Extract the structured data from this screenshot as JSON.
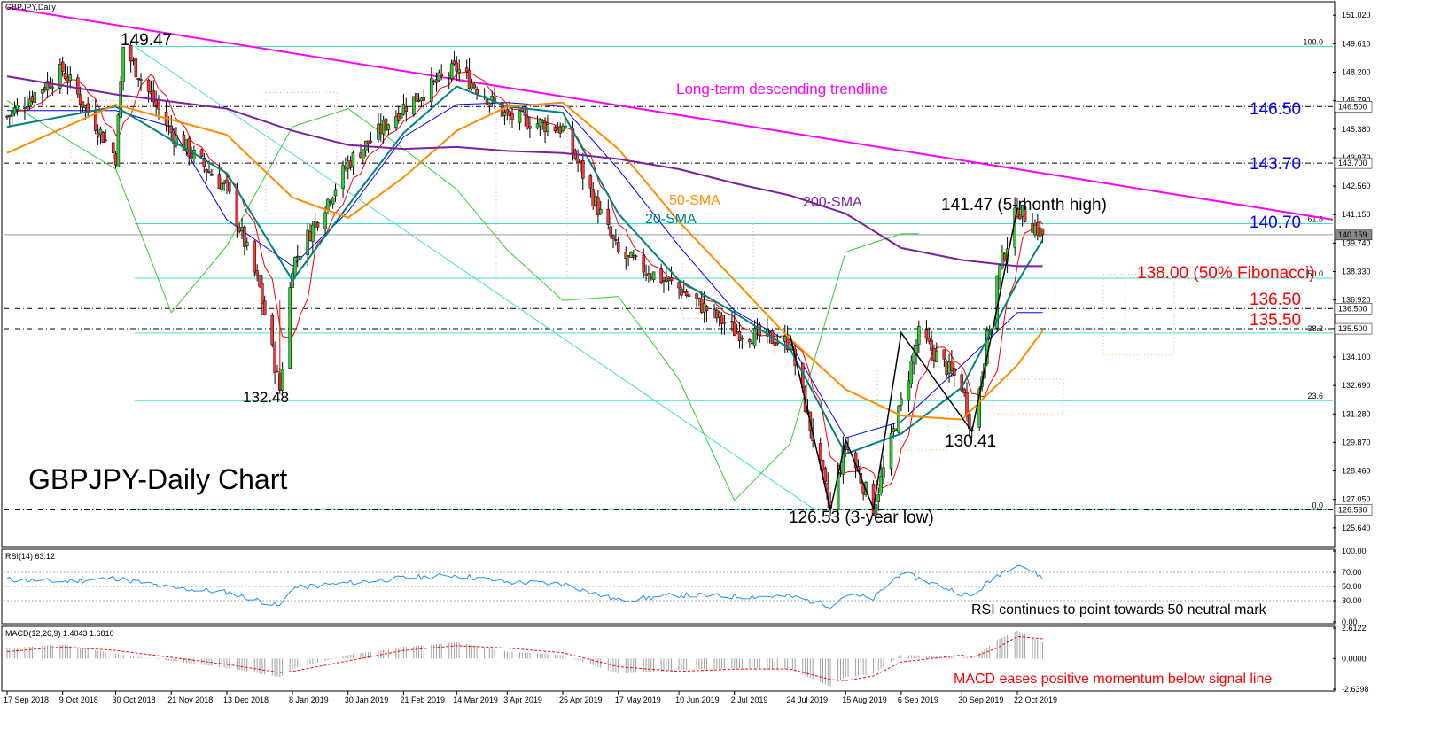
{
  "chart_data": [
    {
      "type": "candlestick",
      "title": "GBPJPY-Daily Chart",
      "symbol_label": "GBPJPY,Daily",
      "price_axis": {
        "ylim": [
          124.8,
          151.6
        ],
        "ticks": [
          "151.020",
          "149.610",
          "148.200",
          "146.790",
          "145.380",
          "143.970",
          "142.560",
          "141.150",
          "139.740",
          "138.330",
          "136.920",
          "135.510",
          "134.100",
          "132.690",
          "131.280",
          "129.870",
          "128.460",
          "127.050",
          "125.640"
        ],
        "tick_values": [
          151.02,
          149.61,
          148.2,
          146.79,
          145.38,
          143.97,
          142.56,
          141.15,
          139.74,
          138.33,
          136.92,
          135.51,
          134.1,
          132.69,
          131.28,
          129.87,
          128.46,
          127.05,
          125.64
        ],
        "current_price": "140.159",
        "current_price_value": 140.159
      },
      "x_axis": {
        "tick_labels": [
          "17 Sep 2018",
          "9 Oct 2018",
          "30 Oct 2018",
          "21 Nov 2018",
          "13 Dec 2018",
          "8 Jan 2019",
          "30 Jan 2019",
          "21 Feb 2019",
          "14 Mar 2019",
          "3 Apr 2019",
          "25 Apr 2019",
          "17 May 2019",
          "10 Jun 2019",
          "2 Jul 2019",
          "24 Jul 2019",
          "15 Aug 2019",
          "6 Sep 2019",
          "30 Sep 2019",
          "22 Oct 2019"
        ]
      },
      "price_path": {
        "name": "GBPJPY close",
        "points": [
          [
            "17 Sep 2018",
            146.0
          ],
          [
            "9 Oct 2018",
            148.3
          ],
          [
            "30 Oct 2018",
            144.0
          ],
          [
            "2 Nov 2018",
            149.47
          ],
          [
            "21 Nov 2018",
            145.2
          ],
          [
            "13 Dec 2018",
            142.4
          ],
          [
            "26 Dec 2018",
            137.5
          ],
          [
            "3 Jan 2019",
            132.48
          ],
          [
            "8 Jan 2019",
            138.7
          ],
          [
            "30 Jan 2019",
            143.7
          ],
          [
            "21 Feb 2019",
            146.5
          ],
          [
            "14 Mar 2019",
            148.4
          ],
          [
            "3 Apr 2019",
            146.0
          ],
          [
            "25 Apr 2019",
            145.4
          ],
          [
            "17 May 2019",
            139.2
          ],
          [
            "10 Jun 2019",
            137.5
          ],
          [
            "2 Jul 2019",
            135.4
          ],
          [
            "24 Jul 2019",
            134.8
          ],
          [
            "9 Aug 2019",
            126.53
          ],
          [
            "15 Aug 2019",
            129.8
          ],
          [
            "26 Aug 2019",
            126.6
          ],
          [
            "6 Sep 2019",
            131.8
          ],
          [
            "13 Sep 2019",
            135.2
          ],
          [
            "30 Sep 2019",
            132.7
          ],
          [
            "4 Oct 2019",
            130.41
          ],
          [
            "14 Oct 2019",
            138.0
          ],
          [
            "22 Oct 2019",
            141.47
          ],
          [
            "1 Nov 2019",
            140.16
          ]
        ]
      },
      "moving_averages": [
        {
          "name": "20-SMA",
          "color": "#008080",
          "points": [
            [
              "17 Sep 2018",
              145.5
            ],
            [
              "30 Oct 2018",
              146.5
            ],
            [
              "13 Dec 2018",
              143.2
            ],
            [
              "8 Jan 2019",
              137.9
            ],
            [
              "30 Jan 2019",
              141.6
            ],
            [
              "21 Feb 2019",
              145.2
            ],
            [
              "14 Mar 2019",
              147.5
            ],
            [
              "3 Apr 2019",
              146.5
            ],
            [
              "25 Apr 2019",
              146.2
            ],
            [
              "17 May 2019",
              141.2
            ],
            [
              "10 Jun 2019",
              137.9
            ],
            [
              "2 Jul 2019",
              136.3
            ],
            [
              "24 Jul 2019",
              134.5
            ],
            [
              "15 Aug 2019",
              129.3
            ],
            [
              "6 Sep 2019",
              130.3
            ],
            [
              "30 Sep 2019",
              132.6
            ],
            [
              "22 Oct 2019",
              137.8
            ],
            [
              "1 Nov 2019",
              139.9
            ]
          ]
        },
        {
          "name": "50-SMA",
          "color": "#ff8c00",
          "points": [
            [
              "17 Sep 2018",
              144.2
            ],
            [
              "30 Oct 2018",
              146.6
            ],
            [
              "13 Dec 2018",
              145.1
            ],
            [
              "8 Jan 2019",
              142.0
            ],
            [
              "30 Jan 2019",
              141.0
            ],
            [
              "21 Feb 2019",
              143.0
            ],
            [
              "14 Mar 2019",
              145.3
            ],
            [
              "3 Apr 2019",
              146.5
            ],
            [
              "25 Apr 2019",
              146.7
            ],
            [
              "17 May 2019",
              144.4
            ],
            [
              "10 Jun 2019",
              140.8
            ],
            [
              "2 Jul 2019",
              137.9
            ],
            [
              "24 Jul 2019",
              135.0
            ],
            [
              "15 Aug 2019",
              132.5
            ],
            [
              "6 Sep 2019",
              131.2
            ],
            [
              "30 Sep 2019",
              131.0
            ],
            [
              "22 Oct 2019",
              133.7
            ],
            [
              "1 Nov 2019",
              135.4
            ]
          ]
        },
        {
          "name": "200-SMA",
          "color": "#7b1fa2",
          "points": [
            [
              "17 Sep 2018",
              148.0
            ],
            [
              "30 Oct 2018",
              147.1
            ],
            [
              "13 Dec 2018",
              146.4
            ],
            [
              "8 Jan 2019",
              145.3
            ],
            [
              "30 Jan 2019",
              144.6
            ],
            [
              "21 Feb 2019",
              144.4
            ],
            [
              "14 Mar 2019",
              144.5
            ],
            [
              "3 Apr 2019",
              144.3
            ],
            [
              "25 Apr 2019",
              144.2
            ],
            [
              "17 May 2019",
              143.9
            ],
            [
              "10 Jun 2019",
              143.4
            ],
            [
              "2 Jul 2019",
              142.7
            ],
            [
              "24 Jul 2019",
              142.1
            ],
            [
              "15 Aug 2019",
              141.2
            ],
            [
              "6 Sep 2019",
              139.5
            ],
            [
              "30 Sep 2019",
              138.9
            ],
            [
              "22 Oct 2019",
              138.6
            ],
            [
              "1 Nov 2019",
              138.6
            ]
          ]
        }
      ],
      "ichimoku": {
        "chikou_color": "#33cc33",
        "kijun_color": "#0000ff",
        "tenkan_color": "#ff0000",
        "chikou_points": [
          [
            "17 Sep 2018",
            146.8
          ],
          [
            "9 Oct 2018",
            145.0
          ],
          [
            "30 Oct 2018",
            143.4
          ],
          [
            "21 Nov 2018",
            136.3
          ],
          [
            "13 Dec 2018",
            139.6
          ],
          [
            "8 Jan 2019",
            145.5
          ],
          [
            "30 Jan 2019",
            146.4
          ],
          [
            "21 Feb 2019",
            144.4
          ],
          [
            "14 Mar 2019",
            142.4
          ],
          [
            "3 Apr 2019",
            139.4
          ],
          [
            "25 Apr 2019",
            136.9
          ],
          [
            "17 May 2019",
            137.1
          ],
          [
            "10 Jun 2019",
            133.0
          ],
          [
            "2 Jul 2019",
            127.0
          ],
          [
            "24 Jul 2019",
            129.8
          ],
          [
            "15 Aug 2019",
            139.3
          ],
          [
            "6 Sep 2019",
            140.2
          ],
          [
            "13 Sep 2019",
            140.2
          ]
        ],
        "kijun_points": [
          [
            "17 Sep 2018",
            146.3
          ],
          [
            "9 Oct 2018",
            146.3
          ],
          [
            "30 Oct 2018",
            146.3
          ],
          [
            "21 Nov 2018",
            145.5
          ],
          [
            "13 Dec 2018",
            140.9
          ],
          [
            "8 Jan 2019",
            138.6
          ],
          [
            "30 Jan 2019",
            141.3
          ],
          [
            "21 Feb 2019",
            145.0
          ],
          [
            "14 Mar 2019",
            146.6
          ],
          [
            "3 Apr 2019",
            146.7
          ],
          [
            "25 Apr 2019",
            146.5
          ],
          [
            "17 May 2019",
            143.4
          ],
          [
            "10 Jun 2019",
            139.6
          ],
          [
            "2 Jul 2019",
            136.4
          ],
          [
            "24 Jul 2019",
            134.8
          ],
          [
            "15 Aug 2019",
            130.1
          ],
          [
            "6 Sep 2019",
            130.9
          ],
          [
            "30 Sep 2019",
            133.7
          ],
          [
            "22 Oct 2019",
            136.3
          ],
          [
            "1 Nov 2019",
            136.3
          ]
        ]
      },
      "cloud": {
        "color": "#ff9944",
        "bands": [
          [
            135.5,
            138.1
          ],
          [
            134.2,
            138.2
          ],
          [
            131.3,
            133.0
          ],
          [
            129.5,
            133.5
          ],
          [
            136.0,
            141.2
          ],
          [
            138.0,
            145.9
          ],
          [
            141.2,
            147.2
          ],
          [
            143.9,
            146.8
          ],
          [
            141.2,
            144.5
          ]
        ]
      },
      "fibonacci": {
        "high": 149.47,
        "low": 126.53,
        "levels": [
          {
            "label": "100.0",
            "value": 149.47
          },
          {
            "label": "61.8",
            "value": 140.7
          },
          {
            "label": "50.0",
            "value": 138.0
          },
          {
            "label": "38.2",
            "value": 135.29
          },
          {
            "label": "23.6",
            "value": 131.94
          },
          {
            "label": "0.0",
            "value": 126.53
          }
        ]
      },
      "horizontal_levels": [
        {
          "label": "146.500",
          "value": 146.5
        },
        {
          "label": "143.700",
          "value": 143.7
        },
        {
          "label": "136.500",
          "value": 136.5
        },
        {
          "label": "135.500",
          "value": 135.5
        },
        {
          "label": "126.530",
          "value": 126.53
        }
      ],
      "trendline": {
        "label": "Long-term descending trendline",
        "color": "#ff00ff",
        "from": [
          "17 Sep 2018",
          151.4
        ],
        "to": [
          "1 Dec 2019",
          142.6
        ]
      },
      "annotations": {
        "price_149": "149.47",
        "price_132": "132.48",
        "price_126": "126.53 (3-year low)",
        "price_130": "130.41",
        "price_141": "141.47 (5-month high)",
        "level_146": "146.50",
        "level_143": "143.70",
        "level_140": "140.70",
        "level_138": "138.00 (50% Fibonacci)",
        "level_136": "136.50",
        "level_135": "135.50",
        "sma20": "20-SMA",
        "sma50": "50-SMA",
        "sma200": "200-SMA",
        "colors": {
          "trend": "#ff00ff",
          "blue_levels": "#0000ff",
          "red_levels": "#ff0000",
          "sma20": "#008080",
          "sma50": "#ff8c00",
          "sma200": "#7b1fa2"
        }
      }
    },
    {
      "type": "line",
      "title": "RSI(14) 63.12",
      "ylim": [
        0,
        100
      ],
      "ticks": [
        "100.00",
        "70.00",
        "50.00",
        "30.00",
        "0.00"
      ],
      "tick_values": [
        100,
        70,
        50,
        30,
        0
      ],
      "annotation": "RSI continues to point towards 50 neutral mark",
      "color": "#1e90ff",
      "points": [
        [
          "17 Sep 2018",
          60
        ],
        [
          "9 Oct 2018",
          57
        ],
        [
          "30 Oct 2018",
          62
        ],
        [
          "21 Nov 2018",
          48
        ],
        [
          "13 Dec 2018",
          42
        ],
        [
          "3 Jan 2019",
          22
        ],
        [
          "8 Jan 2019",
          48
        ],
        [
          "30 Jan 2019",
          55
        ],
        [
          "21 Feb 2019",
          62
        ],
        [
          "14 Mar 2019",
          66
        ],
        [
          "3 Apr 2019",
          56
        ],
        [
          "25 Apr 2019",
          54
        ],
        [
          "17 May 2019",
          30
        ],
        [
          "10 Jun 2019",
          38
        ],
        [
          "2 Jul 2019",
          36
        ],
        [
          "24 Jul 2019",
          36
        ],
        [
          "9 Aug 2019",
          23
        ],
        [
          "15 Aug 2019",
          38
        ],
        [
          "26 Aug 2019",
          33
        ],
        [
          "6 Sep 2019",
          70
        ],
        [
          "30 Sep 2019",
          40
        ],
        [
          "4 Oct 2019",
          36
        ],
        [
          "14 Oct 2019",
          66
        ],
        [
          "22 Oct 2019",
          83
        ],
        [
          "1 Nov 2019",
          63
        ]
      ]
    },
    {
      "type": "bar",
      "title": "MACD(12,26,9) 1.4043 1.6810",
      "ylim": [
        -2.6398,
        2.6122
      ],
      "ticks": [
        "2.6122",
        "0.0000",
        "-2.6398"
      ],
      "tick_values": [
        2.6122,
        0,
        -2.6398
      ],
      "annotation": "MACD eases positive momentum below signal line",
      "histogram_color": "#a0a0a0",
      "signal_color": "#ff0000",
      "macd_points": [
        [
          "17 Sep 2018",
          0.9
        ],
        [
          "9 Oct 2018",
          1.2
        ],
        [
          "30 Oct 2018",
          0.4
        ],
        [
          "21 Nov 2018",
          -0.2
        ],
        [
          "13 Dec 2018",
          -0.8
        ],
        [
          "3 Jan 2019",
          -1.6
        ],
        [
          "8 Jan 2019",
          -0.9
        ],
        [
          "30 Jan 2019",
          0.3
        ],
        [
          "21 Feb 2019",
          1.0
        ],
        [
          "14 Mar 2019",
          1.4
        ],
        [
          "3 Apr 2019",
          0.6
        ],
        [
          "25 Apr 2019",
          0.3
        ],
        [
          "17 May 2019",
          -1.3
        ],
        [
          "10 Jun 2019",
          -1.0
        ],
        [
          "2 Jul 2019",
          -0.8
        ],
        [
          "24 Jul 2019",
          -0.9
        ],
        [
          "9 Aug 2019",
          -2.4
        ],
        [
          "15 Aug 2019",
          -1.6
        ],
        [
          "26 Aug 2019",
          -1.3
        ],
        [
          "6 Sep 2019",
          0.3
        ],
        [
          "30 Sep 2019",
          0.2
        ],
        [
          "4 Oct 2019",
          0.0
        ],
        [
          "14 Oct 2019",
          1.6
        ],
        [
          "22 Oct 2019",
          2.4
        ],
        [
          "1 Nov 2019",
          1.4
        ]
      ],
      "signal_points": [
        [
          "17 Sep 2018",
          0.6
        ],
        [
          "9 Oct 2018",
          1.0
        ],
        [
          "30 Oct 2018",
          0.7
        ],
        [
          "21 Nov 2018",
          0.1
        ],
        [
          "13 Dec 2018",
          -0.5
        ],
        [
          "3 Jan 2019",
          -1.2
        ],
        [
          "8 Jan 2019",
          -1.1
        ],
        [
          "30 Jan 2019",
          -0.2
        ],
        [
          "21 Feb 2019",
          0.7
        ],
        [
          "14 Mar 2019",
          1.1
        ],
        [
          "3 Apr 2019",
          0.9
        ],
        [
          "25 Apr 2019",
          0.5
        ],
        [
          "17 May 2019",
          -0.7
        ],
        [
          "10 Jun 2019",
          -1.1
        ],
        [
          "2 Jul 2019",
          -0.9
        ],
        [
          "24 Jul 2019",
          -0.9
        ],
        [
          "9 Aug 2019",
          -1.8
        ],
        [
          "15 Aug 2019",
          -1.9
        ],
        [
          "26 Aug 2019",
          -1.5
        ],
        [
          "6 Sep 2019",
          -0.3
        ],
        [
          "30 Sep 2019",
          0.3
        ],
        [
          "4 Oct 2019",
          0.1
        ],
        [
          "14 Oct 2019",
          0.9
        ],
        [
          "22 Oct 2019",
          1.9
        ],
        [
          "1 Nov 2019",
          1.7
        ]
      ]
    }
  ]
}
